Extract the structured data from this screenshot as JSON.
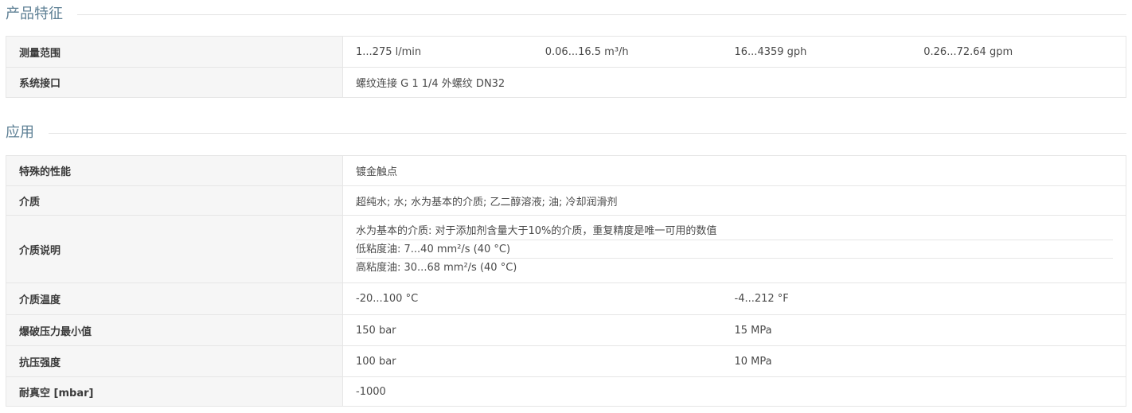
{
  "section1": {
    "title": "产品特征",
    "rows": [
      {
        "label": "测量范围",
        "values": [
          "1...275 l/min",
          "0.06...16.5 m³/h",
          "16...4359 gph",
          "0.26...72.64 gpm"
        ]
      },
      {
        "label": "系统接口",
        "value": "螺纹连接 G 1 1/4 外螺纹 DN32"
      }
    ]
  },
  "section2": {
    "title": "应用",
    "rows": [
      {
        "label": "特殊的性能",
        "value": "镀金触点"
      },
      {
        "label": "介质",
        "value": "超纯水; 水; 水为基本的介质; 乙二醇溶液; 油; 冷却润滑剂"
      },
      {
        "label": "介质说明",
        "lines": [
          "水为基本的介质: 对于添加剂含量大于10%的介质，重复精度是唯一可用的数值",
          "低粘度油: 7...40 mm²/s (40 °C)",
          "高粘度油: 30...68 mm²/s (40 °C)"
        ]
      },
      {
        "label": "介质温度",
        "values": [
          "-20...100 °C",
          "-4...212 °F"
        ]
      },
      {
        "label": "爆破压力最小值",
        "values": [
          "150 bar",
          "15 MPa"
        ]
      },
      {
        "label": "抗压强度",
        "values": [
          "100 bar",
          "10 MPa"
        ]
      },
      {
        "label": "耐真空 [mbar]",
        "value": "-1000"
      }
    ]
  }
}
